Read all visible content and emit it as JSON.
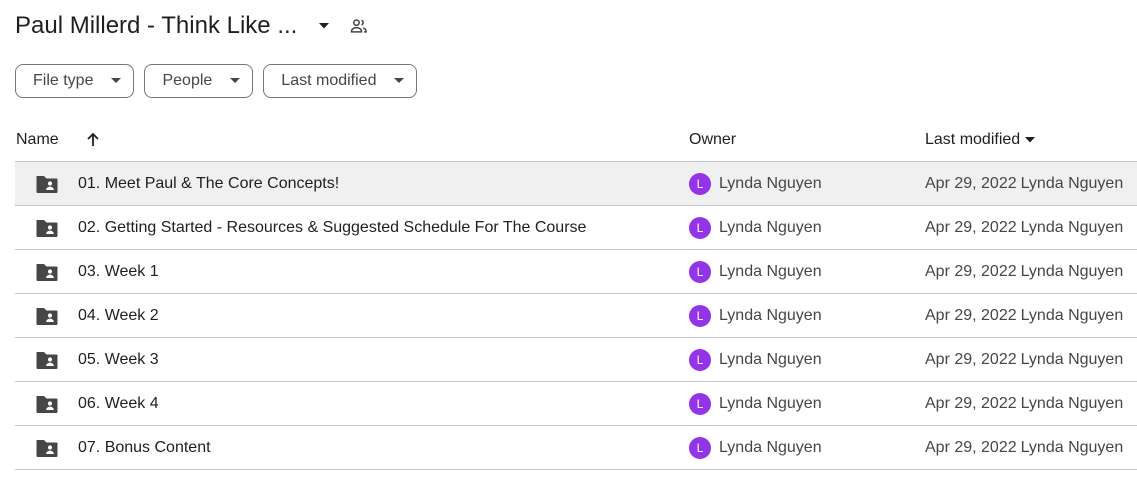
{
  "header": {
    "title": "Paul Millerd - Think Like ...",
    "caret_icon": "arrow-drop-down-icon",
    "shared_icon": "people-icon"
  },
  "filters": [
    {
      "label": "File type",
      "icon": "arrow-drop-down-icon"
    },
    {
      "label": "People",
      "icon": "arrow-drop-down-icon"
    },
    {
      "label": "Last modified",
      "icon": "arrow-drop-down-icon"
    }
  ],
  "columns": {
    "name": "Name",
    "name_sort_icon": "arrow-upward-icon",
    "owner": "Owner",
    "last_modified": "Last modified",
    "last_modified_icon": "arrow-drop-down-icon"
  },
  "colors": {
    "avatar": "#9334e6",
    "selected_row": "#f0f0f0",
    "folder_icon": "#444746"
  },
  "rows": [
    {
      "name": "01. Meet Paul & The Core Concepts!",
      "owner": "Lynda Nguyen",
      "owner_initial": "L",
      "date": "Apr 29, 2022",
      "modified_by": "Lynda Nguyen",
      "icon": "shared-folder-icon"
    },
    {
      "name": "02. Getting Started - Resources & Suggested Schedule For The Course",
      "owner": "Lynda Nguyen",
      "owner_initial": "L",
      "date": "Apr 29, 2022",
      "modified_by": "Lynda Nguyen",
      "icon": "shared-folder-icon"
    },
    {
      "name": "03. Week 1",
      "owner": "Lynda Nguyen",
      "owner_initial": "L",
      "date": "Apr 29, 2022",
      "modified_by": "Lynda Nguyen",
      "icon": "shared-folder-icon"
    },
    {
      "name": "04. Week 2",
      "owner": "Lynda Nguyen",
      "owner_initial": "L",
      "date": "Apr 29, 2022",
      "modified_by": "Lynda Nguyen",
      "icon": "shared-folder-icon"
    },
    {
      "name": "05. Week 3",
      "owner": "Lynda Nguyen",
      "owner_initial": "L",
      "date": "Apr 29, 2022",
      "modified_by": "Lynda Nguyen",
      "icon": "shared-folder-icon"
    },
    {
      "name": "06. Week 4",
      "owner": "Lynda Nguyen",
      "owner_initial": "L",
      "date": "Apr 29, 2022",
      "modified_by": "Lynda Nguyen",
      "icon": "shared-folder-icon"
    },
    {
      "name": "07. Bonus Content",
      "owner": "Lynda Nguyen",
      "owner_initial": "L",
      "date": "Apr 29, 2022",
      "modified_by": "Lynda Nguyen",
      "icon": "shared-folder-icon"
    }
  ]
}
